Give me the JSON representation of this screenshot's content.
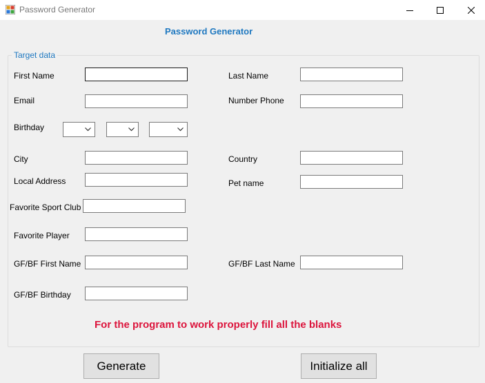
{
  "window": {
    "title": "Password Generator"
  },
  "form": {
    "heading": "Password Generator",
    "group_title": "Target data",
    "labels": {
      "first_name": "First Name",
      "last_name": "Last Name",
      "email": "Email",
      "number_phone": "Number Phone",
      "birthday": "Birthday",
      "city": "City",
      "country": "Country",
      "local_address": "Local Address",
      "pet_name": "Pet name",
      "favorite_sport_club": "Favorite Sport Club",
      "favorite_player": "Favorite Player",
      "gf_bf_first_name": "GF/BF First Name",
      "gf_bf_last_name": "GF/BF Last Name",
      "gf_bf_birthday": "GF/BF Birthday"
    },
    "values": {
      "first_name": "",
      "last_name": "",
      "email": "",
      "number_phone": "",
      "birthday_day": "",
      "birthday_month": "",
      "birthday_year": "",
      "city": "",
      "country": "",
      "local_address": "",
      "pet_name": "",
      "favorite_sport_club": "",
      "favorite_player": "",
      "gf_bf_first_name": "",
      "gf_bf_last_name": "",
      "gf_bf_birthday": ""
    },
    "warning": "For the program to work properly fill all the blanks",
    "warning_color": "#dc143c",
    "accent_color": "#1e78c0"
  },
  "buttons": {
    "generate": "Generate",
    "initialize_all": "Initialize all"
  },
  "icons": {
    "app": "app-icon",
    "minimize": "minimize-icon",
    "maximize": "maximize-icon",
    "close": "close-icon",
    "dropdown": "chevron-down-icon"
  }
}
